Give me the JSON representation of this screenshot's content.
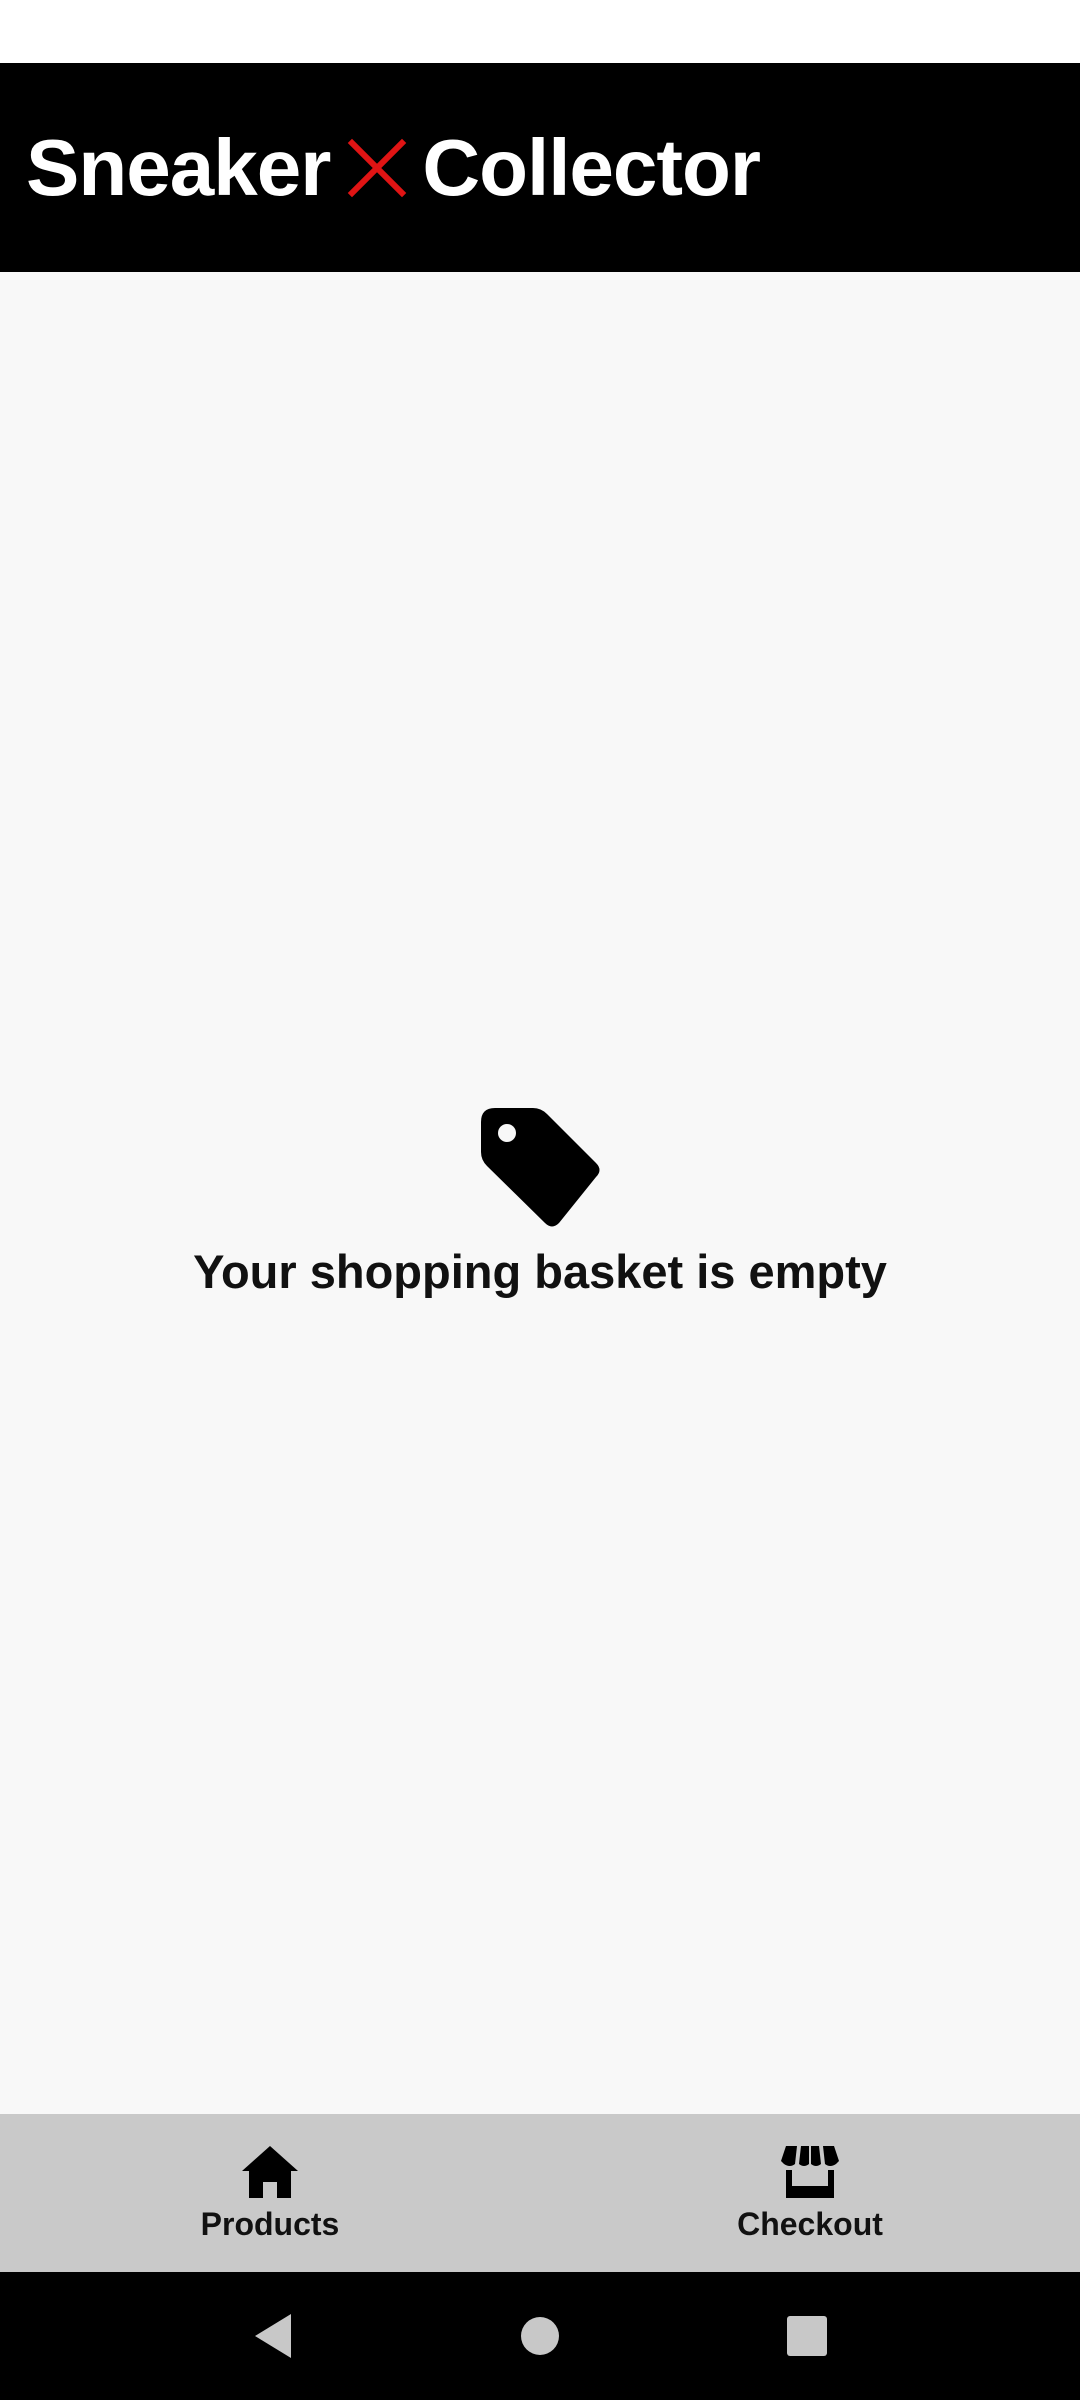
{
  "header": {
    "brand_left": "Sneaker",
    "brand_right": "Collector",
    "brand_mark_color": "#e01414"
  },
  "empty_state": {
    "icon": "tag-icon",
    "message": "Your shopping basket is empty"
  },
  "bottom_nav": {
    "items": [
      {
        "label": "Products",
        "icon": "home-icon"
      },
      {
        "label": "Checkout",
        "icon": "store-icon"
      }
    ]
  },
  "system_nav": {
    "buttons": [
      "back-icon",
      "home-circle-icon",
      "recents-icon"
    ]
  }
}
